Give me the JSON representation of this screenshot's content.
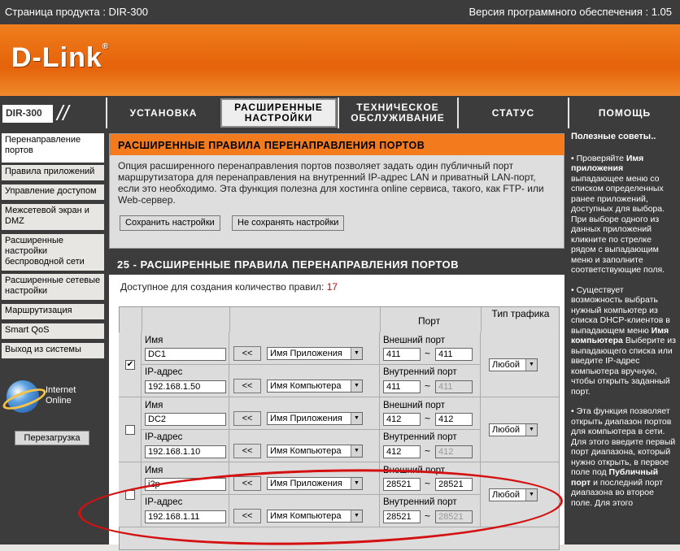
{
  "topbar": {
    "product": "Страница продукта :  DIR-300",
    "firmware": "Версия программного обеспечения : 1.05"
  },
  "brand": {
    "logo": "D-Link",
    "model": "DIR-300"
  },
  "nav": {
    "tabs": [
      "УСТАНОВКА",
      "РАСШИРЕННЫЕ НАСТРОЙКИ",
      "ТЕХНИЧЕСКОЕ ОБСЛУЖИВАНИЕ",
      "СТАТУС",
      "ПОМОЩЬ"
    ]
  },
  "sidebar": {
    "items": [
      "Перенаправление портов",
      "Правила приложений",
      "Управление доступом",
      "Межсетевой экран и DMZ",
      "Расширенные настройки беспроводной сети",
      "Расширенные сетевые настройки",
      "Маршрутизация",
      "Smart QoS",
      "Выход из системы"
    ],
    "internet": "Internet Online",
    "reboot": "Перезагрузка"
  },
  "intro": {
    "title": "РАСШИРЕННЫЕ ПРАВИЛА ПЕРЕНАПРАВЛЕНИЯ ПОРТОВ",
    "text": "Опция расширенного перенаправления портов позволяет задать один публичный порт маршрутизатора для перенаправления на внутренний IP-адрес LAN и приватный LAN-порт, если это необходимо. Эта функция полезна для хостинга online сервиса, такого, как FTP- или Web-сервер.",
    "save": "Сохранить настройки",
    "nosave": "Не сохранять настройки"
  },
  "rules": {
    "title": "25 - РАСШИРЕННЫЕ ПРАВИЛА ПЕРЕНАПРАВЛЕНИЯ ПОРТОВ",
    "available_label": "Доступное для создания количество правил:",
    "available": "17",
    "col_port": "Порт",
    "col_type": "Тип трафика",
    "name_label": "Имя",
    "ip_label": "IP-адрес",
    "ext_label": "Внешний порт",
    "int_label": "Внутренний порт",
    "arrow": "<<",
    "app_sel": "Имя Приложения",
    "pc_sel": "Имя Компьютера",
    "tilde": "~",
    "rows": [
      {
        "checked": "✔",
        "name": "DC1",
        "ip": "192.168.1.50",
        "ext_from": "411",
        "ext_to": "411",
        "int_from": "411",
        "int_to": "411",
        "type": "Любой"
      },
      {
        "checked": "",
        "name": "DC2",
        "ip": "192.168.1.10",
        "ext_from": "412",
        "ext_to": "412",
        "int_from": "412",
        "int_to": "412",
        "type": "Любой"
      },
      {
        "checked": "",
        "name": "i2p",
        "ip": "192.168.1.11",
        "ext_from": "28521",
        "ext_to": "28521",
        "int_from": "28521",
        "int_to": "28521",
        "type": "Любой"
      }
    ]
  },
  "help": {
    "title": "Полезные советы..",
    "p1a": "Проверяйте ",
    "p1b": "Имя приложения",
    "p1c": " выпадающее меню со списком определенных ранее приложений, доступных для выбора. При выборе одного из данных приложений кликните по стрелке рядом с выпадающим меню и заполните соответствующие поля.",
    "p2a": "Существует возможность выбрать нужный компьютер из списка DHCP-клиентов в выпадающем меню ",
    "p2b": "Имя компьютера",
    "p2c": " Выберите из выпадающего списка или введите IP-адрес компьютера вручную, чтобы открыть заданный порт.",
    "p3a": "Эта функция позволяет открыть диапазон портов для компьютера в сети. Для этого введите первый порт диапазона, который нужно открыть, в первое поле под ",
    "p3b": "Публичный порт",
    "p3c": " и последний порт диапазона во второе поле. Для этого"
  },
  "colors": {
    "orange": "#f47a1e",
    "dark": "#3c3c3c",
    "annotation": "#d41010"
  }
}
